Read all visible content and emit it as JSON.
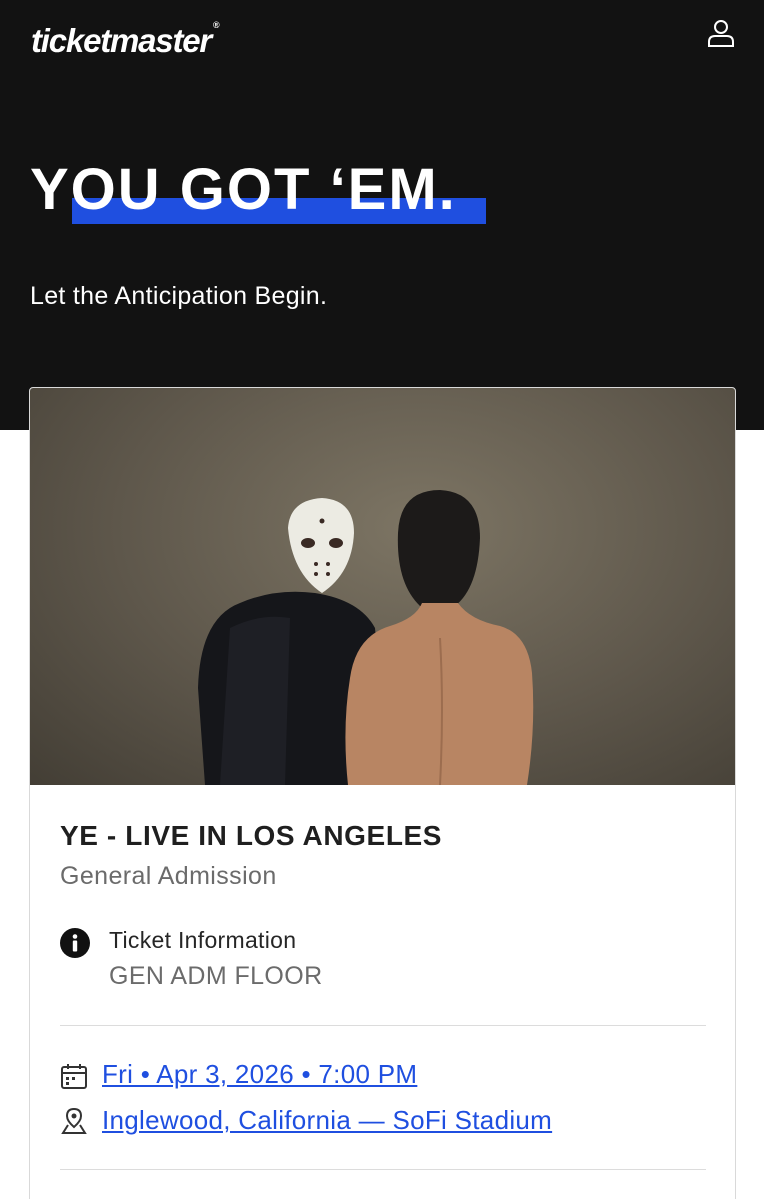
{
  "header": {
    "logo_text": "ticketmaster",
    "logo_mark": "®",
    "account_icon": "user-icon",
    "headline": "YOU GOT ‘EM.",
    "subheadline": "Let the Anticipation Begin.",
    "accent_color": "#1f4fe0",
    "background_color": "#121212"
  },
  "event": {
    "image_icon": "event-artwork",
    "title": "YE - LIVE IN LOS ANGELES",
    "subtitle": "General Admission",
    "ticket_info": {
      "icon": "info-icon",
      "label": "Ticket Information",
      "value": "GEN ADM FLOOR"
    },
    "date": {
      "icon": "calendar-icon",
      "text": "Fri • Apr 3, 2026 • 7:00 PM"
    },
    "location": {
      "icon": "map-pin-icon",
      "text": "Inglewood, California — SoFi Stadium"
    }
  }
}
